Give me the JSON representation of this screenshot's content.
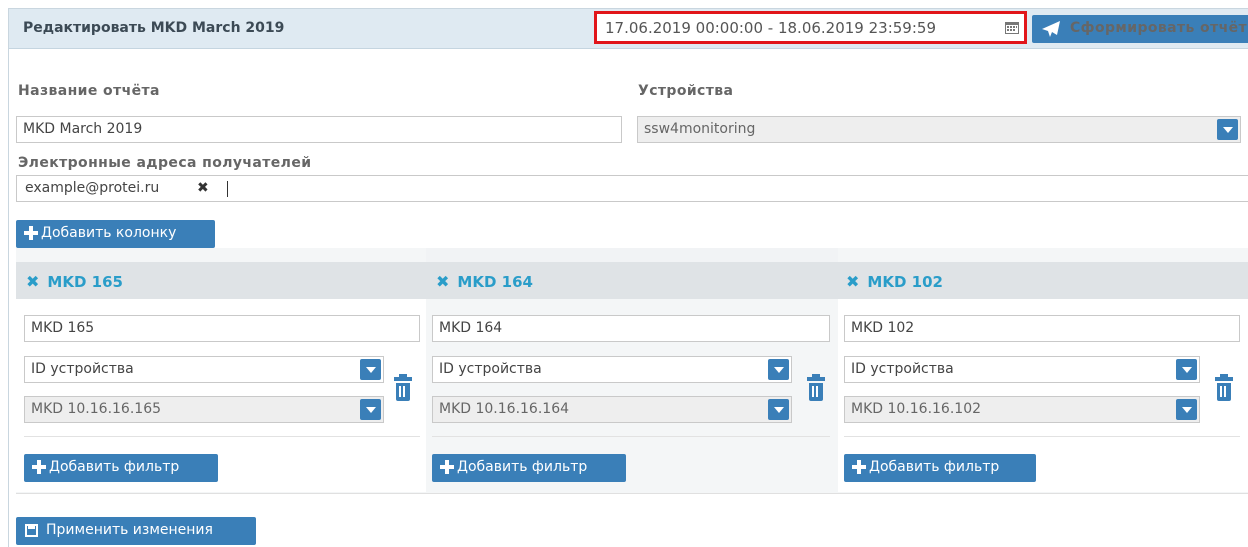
{
  "header": {
    "title": "Редактировать MKD March 2019",
    "date_range": "17.06.2019 00:00:00 - 18.06.2019 23:59:59",
    "generate_report_label": "Сформировать отчёт"
  },
  "form": {
    "report_name_label": "Название отчёта",
    "report_name_value": "MKD March 2019",
    "devices_label": "Устройства",
    "devices_value": "ssw4monitoring",
    "emails_label": "Электронные адреса получателей",
    "email_tags": [
      "example@protei.ru"
    ],
    "add_column_label": "Добавить колонку"
  },
  "columns": [
    {
      "title": "MKD 165",
      "name_value": "MKD 165",
      "field_value": "ID устройства",
      "filter_value": "MKD 10.16.16.165",
      "add_filter_label": "Добавить фильтр"
    },
    {
      "title": "MKD 164",
      "name_value": "MKD 164",
      "field_value": "ID устройства",
      "filter_value": "MKD 10.16.16.164",
      "add_filter_label": "Добавить фильтр"
    },
    {
      "title": "MKD 102",
      "name_value": "MKD 102",
      "field_value": "ID устройства",
      "filter_value": "MKD 10.16.16.102",
      "add_filter_label": "Добавить фильтр"
    }
  ],
  "footer": {
    "apply_label": "Применить изменения"
  },
  "colors": {
    "accent": "#3a7fb8",
    "header_bg": "#dfeaf2",
    "highlight_border": "#e1151a",
    "column_title": "#2a9dc9"
  }
}
